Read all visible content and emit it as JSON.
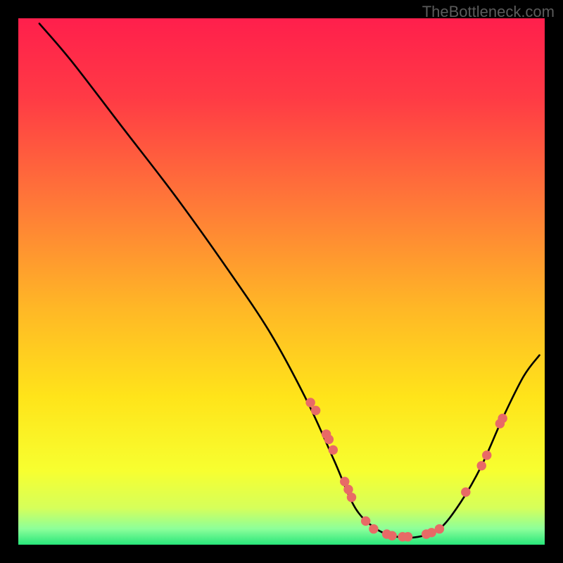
{
  "watermark": "TheBottleneck.com",
  "chart_data": {
    "type": "line",
    "title": "",
    "xlabel": "",
    "ylabel": "",
    "xlim": [
      0,
      100
    ],
    "ylim": [
      0,
      100
    ],
    "curve": [
      {
        "x": 4,
        "y": 99
      },
      {
        "x": 10,
        "y": 92
      },
      {
        "x": 20,
        "y": 79
      },
      {
        "x": 30,
        "y": 66
      },
      {
        "x": 40,
        "y": 52
      },
      {
        "x": 48,
        "y": 40
      },
      {
        "x": 55,
        "y": 27
      },
      {
        "x": 60,
        "y": 16
      },
      {
        "x": 64,
        "y": 7
      },
      {
        "x": 68,
        "y": 3
      },
      {
        "x": 72,
        "y": 1.5
      },
      {
        "x": 76,
        "y": 1.5
      },
      {
        "x": 80,
        "y": 3
      },
      {
        "x": 84,
        "y": 8
      },
      {
        "x": 88,
        "y": 15
      },
      {
        "x": 92,
        "y": 24
      },
      {
        "x": 96,
        "y": 32
      },
      {
        "x": 99,
        "y": 36
      }
    ],
    "markers": [
      {
        "x": 55.5,
        "y": 27
      },
      {
        "x": 56.5,
        "y": 25.5
      },
      {
        "x": 58.5,
        "y": 21
      },
      {
        "x": 59.0,
        "y": 20
      },
      {
        "x": 59.8,
        "y": 18
      },
      {
        "x": 62.0,
        "y": 12
      },
      {
        "x": 62.7,
        "y": 10.5
      },
      {
        "x": 63.3,
        "y": 9
      },
      {
        "x": 66.0,
        "y": 4.5
      },
      {
        "x": 67.5,
        "y": 3
      },
      {
        "x": 70.0,
        "y": 2
      },
      {
        "x": 71.0,
        "y": 1.7
      },
      {
        "x": 73.0,
        "y": 1.5
      },
      {
        "x": 74.0,
        "y": 1.5
      },
      {
        "x": 77.5,
        "y": 2
      },
      {
        "x": 78.5,
        "y": 2.3
      },
      {
        "x": 80.0,
        "y": 3
      },
      {
        "x": 85.0,
        "y": 10
      },
      {
        "x": 88.0,
        "y": 15
      },
      {
        "x": 89.0,
        "y": 17
      },
      {
        "x": 91.5,
        "y": 23
      },
      {
        "x": 92.0,
        "y": 24
      }
    ],
    "gradient_stops": [
      {
        "offset": 0.0,
        "color": "#ff1f4c"
      },
      {
        "offset": 0.15,
        "color": "#ff3a45"
      },
      {
        "offset": 0.35,
        "color": "#ff7838"
      },
      {
        "offset": 0.55,
        "color": "#ffb726"
      },
      {
        "offset": 0.72,
        "color": "#ffe41a"
      },
      {
        "offset": 0.86,
        "color": "#f7ff30"
      },
      {
        "offset": 0.93,
        "color": "#d6ff5a"
      },
      {
        "offset": 0.97,
        "color": "#8cff9a"
      },
      {
        "offset": 1.0,
        "color": "#28e67a"
      }
    ]
  }
}
